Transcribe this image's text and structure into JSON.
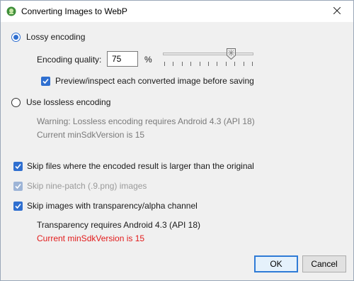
{
  "window": {
    "title": "Converting Images to WebP"
  },
  "lossy": {
    "label": "Lossy encoding",
    "quality_label": "Encoding quality:",
    "quality_value": "75",
    "percent_sign": "%",
    "slider_value_percent": 75,
    "preview_label": "Preview/inspect each converted image before saving"
  },
  "lossless": {
    "label": "Use lossless encoding",
    "warning": "Warning: Lossless encoding requires Android 4.3 (API 18)",
    "min_sdk": "Current minSdkVersion is 15"
  },
  "options": {
    "skip_larger": "Skip files where the encoded result is larger than the original",
    "skip_ninepatch": "Skip nine-patch (.9.png) images",
    "skip_transparency": "Skip images with transparency/alpha channel",
    "transparency_note": "Transparency requires Android 4.3 (API 18)",
    "transparency_min_sdk": "Current minSdkVersion is 15"
  },
  "buttons": {
    "ok": "OK",
    "cancel": "Cancel"
  },
  "colors": {
    "accent": "#2f6fd0",
    "error": "#e21b1b",
    "muted": "#7a7a7a"
  },
  "icons": {
    "app": "android-studio-icon",
    "close": "close-icon",
    "check": "checkmark-icon"
  }
}
